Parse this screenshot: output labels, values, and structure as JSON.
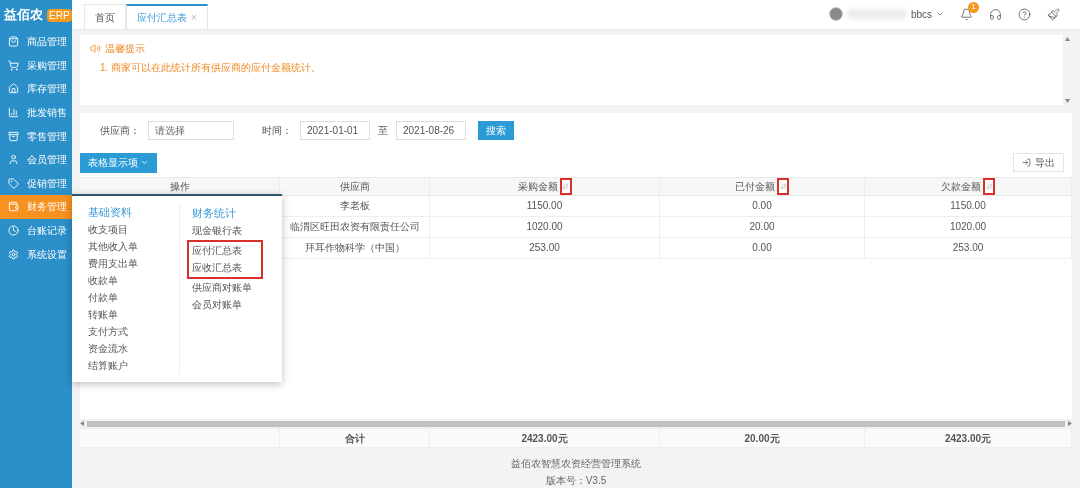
{
  "logo": {
    "name": "益佰农",
    "badge": "ERP"
  },
  "sidebar": {
    "items": [
      {
        "label": "商品管理",
        "selected": false
      },
      {
        "label": "采购管理",
        "selected": false
      },
      {
        "label": "库存管理",
        "selected": false
      },
      {
        "label": "批发销售",
        "selected": false
      },
      {
        "label": "零售管理",
        "selected": false
      },
      {
        "label": "会员管理",
        "selected": false
      },
      {
        "label": "促销管理",
        "selected": false
      },
      {
        "label": "财务管理",
        "selected": true
      },
      {
        "label": "台账记录",
        "selected": false
      },
      {
        "label": "系统设置",
        "selected": false
      }
    ]
  },
  "tabs": [
    {
      "label": "首页",
      "selected": false
    },
    {
      "label": "应付汇总表",
      "selected": true,
      "close": "×"
    }
  ],
  "user": {
    "name": "bbcs",
    "notifications": "1"
  },
  "notice": {
    "title": "温馨提示",
    "lines": [
      "1. 商家可以在此统计所有供应商的应付金额统计。"
    ]
  },
  "filters": {
    "supplier_label": "供应商：",
    "supplier_placeholder": "请选择",
    "time_label": "时间：",
    "start": "2021-01-01",
    "to": "至",
    "end": "2021-08-26",
    "search": "搜索"
  },
  "columns_button": "表格显示项",
  "export_button": "导出",
  "table": {
    "columns": [
      {
        "label": "操作",
        "sortable": false,
        "highlighted": false
      },
      {
        "label": "供应商",
        "sortable": false,
        "highlighted": false
      },
      {
        "label": "采购金额",
        "sortable": true,
        "highlighted": true
      },
      {
        "label": "已付金额",
        "sortable": true,
        "highlighted": true
      },
      {
        "label": "欠款金额",
        "sortable": true,
        "highlighted": true
      }
    ],
    "rows": [
      {
        "supplier": "李老板",
        "purchase": "1150.00",
        "paid": "0.00",
        "owed": "1150.00"
      },
      {
        "supplier": "临渭区旺田农资有限责任公司",
        "purchase": "1020.00",
        "paid": "20.00",
        "owed": "1020.00"
      },
      {
        "supplier": "拜耳作物科学（中国）",
        "purchase": "253.00",
        "paid": "0.00",
        "owed": "253.00"
      }
    ],
    "totals": {
      "label": "合计",
      "purchase": "2423.00元",
      "paid": "20.00元",
      "owed": "2423.00元"
    }
  },
  "menu": {
    "groups": [
      {
        "title": "基础资料",
        "items": [
          {
            "label": "收支项目",
            "highlighted": false
          },
          {
            "label": "其他收入单",
            "highlighted": false
          },
          {
            "label": "费用支出单",
            "highlighted": false
          },
          {
            "label": "收款单",
            "highlighted": false
          },
          {
            "label": "付款单",
            "highlighted": false
          },
          {
            "label": "转账单",
            "highlighted": false
          },
          {
            "label": "支付方式",
            "highlighted": false
          },
          {
            "label": "资金流水",
            "highlighted": false
          },
          {
            "label": "结算账户",
            "highlighted": false
          }
        ]
      },
      {
        "title": "财务统计",
        "items": [
          {
            "label": "现金银行表",
            "highlighted": false
          },
          {
            "label": "应付汇总表",
            "highlighted": true
          },
          {
            "label": "应收汇总表",
            "highlighted": true
          },
          {
            "label": "供应商对账单",
            "highlighted": false
          },
          {
            "label": "会员对账单",
            "highlighted": false
          }
        ]
      }
    ]
  },
  "footer": [
    "益佰农智慧农资经营管理系统",
    "版本号：V3.5"
  ]
}
